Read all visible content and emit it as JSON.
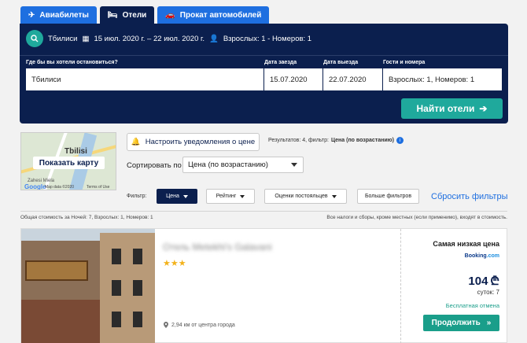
{
  "tabs": [
    {
      "label": "Авиабилеты",
      "icon": "plane-icon"
    },
    {
      "label": "Отели",
      "icon": "bed-icon"
    },
    {
      "label": "Прокат автомобилей",
      "icon": "car-icon"
    }
  ],
  "summary": {
    "city": "Тбилиси",
    "dates": "15 июл. 2020 г. – 22 июл. 2020 г.",
    "guests": "Взрослых: 1 - Номеров: 1"
  },
  "form": {
    "destination_label": "Где бы вы хотели остановиться?",
    "destination_value": "Tбилиси",
    "checkin_label": "Дата заезда",
    "checkin_value": "15.07.2020",
    "checkout_label": "Дата выезда",
    "checkout_value": "22.07.2020",
    "guests_label": "Гости и номера",
    "guests_value": "Взрослых: 1, Номеров: 1",
    "find_button": "Найти отели"
  },
  "map": {
    "city_label": "Tbilisi",
    "show_map_button": "Показать карту",
    "place_label": "Zahesi Miela",
    "google_label": "Google",
    "map_data": "Map data ©2020",
    "terms": "Terms of Use"
  },
  "alerts_button": "Настроить уведомления о цене",
  "results": {
    "prefix": "Результатов: 4, фильтр:",
    "filter_value": "Цена (по возрастанию)"
  },
  "sort": {
    "label": "Сортировать по",
    "selected": "Цена (по возрастанию)"
  },
  "filters": {
    "label": "Фильтр:",
    "chips": [
      "Цена",
      "Рейтинг",
      "Оценки постояльцев",
      "Больше фильтров"
    ],
    "reset": "Сбросить фильтры"
  },
  "totals": {
    "left": "Общая стоимость за Ночей: 7, Взрослых: 1, Номеров: 1",
    "right": "Все налоги и сборы, кроме местных (если применимо), входят в стоимость."
  },
  "hotel": {
    "name": "Отель Metekhi's Galavani",
    "stars": "★★★",
    "star_count": 3,
    "distance": "2,94 км от центра города",
    "lowest_price_label": "Самая низкая цена",
    "partner": "Booking",
    "partner_suffix": ".com",
    "price": "104",
    "currency_icon": "lari-icon",
    "nights": "суток: 7",
    "free_cancel": "Бесплатная отмена",
    "continue_button": "Продолжить"
  },
  "colors": {
    "navy": "#0b1f4e",
    "blue": "#1e6fe0",
    "teal": "#1fa99c",
    "star": "#f3b21b"
  }
}
